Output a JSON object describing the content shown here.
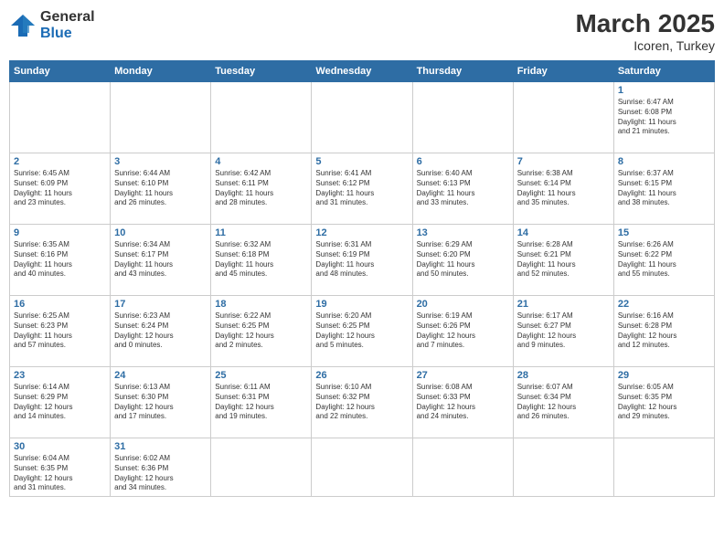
{
  "header": {
    "logo_general": "General",
    "logo_blue": "Blue",
    "title": "March 2025",
    "subtitle": "Icoren, Turkey"
  },
  "days_of_week": [
    "Sunday",
    "Monday",
    "Tuesday",
    "Wednesday",
    "Thursday",
    "Friday",
    "Saturday"
  ],
  "weeks": [
    [
      {
        "day": "",
        "info": ""
      },
      {
        "day": "",
        "info": ""
      },
      {
        "day": "",
        "info": ""
      },
      {
        "day": "",
        "info": ""
      },
      {
        "day": "",
        "info": ""
      },
      {
        "day": "",
        "info": ""
      },
      {
        "day": "1",
        "info": "Sunrise: 6:47 AM\nSunset: 6:08 PM\nDaylight: 11 hours\nand 21 minutes."
      }
    ],
    [
      {
        "day": "2",
        "info": "Sunrise: 6:45 AM\nSunset: 6:09 PM\nDaylight: 11 hours\nand 23 minutes."
      },
      {
        "day": "3",
        "info": "Sunrise: 6:44 AM\nSunset: 6:10 PM\nDaylight: 11 hours\nand 26 minutes."
      },
      {
        "day": "4",
        "info": "Sunrise: 6:42 AM\nSunset: 6:11 PM\nDaylight: 11 hours\nand 28 minutes."
      },
      {
        "day": "5",
        "info": "Sunrise: 6:41 AM\nSunset: 6:12 PM\nDaylight: 11 hours\nand 31 minutes."
      },
      {
        "day": "6",
        "info": "Sunrise: 6:40 AM\nSunset: 6:13 PM\nDaylight: 11 hours\nand 33 minutes."
      },
      {
        "day": "7",
        "info": "Sunrise: 6:38 AM\nSunset: 6:14 PM\nDaylight: 11 hours\nand 35 minutes."
      },
      {
        "day": "8",
        "info": "Sunrise: 6:37 AM\nSunset: 6:15 PM\nDaylight: 11 hours\nand 38 minutes."
      }
    ],
    [
      {
        "day": "9",
        "info": "Sunrise: 6:35 AM\nSunset: 6:16 PM\nDaylight: 11 hours\nand 40 minutes."
      },
      {
        "day": "10",
        "info": "Sunrise: 6:34 AM\nSunset: 6:17 PM\nDaylight: 11 hours\nand 43 minutes."
      },
      {
        "day": "11",
        "info": "Sunrise: 6:32 AM\nSunset: 6:18 PM\nDaylight: 11 hours\nand 45 minutes."
      },
      {
        "day": "12",
        "info": "Sunrise: 6:31 AM\nSunset: 6:19 PM\nDaylight: 11 hours\nand 48 minutes."
      },
      {
        "day": "13",
        "info": "Sunrise: 6:29 AM\nSunset: 6:20 PM\nDaylight: 11 hours\nand 50 minutes."
      },
      {
        "day": "14",
        "info": "Sunrise: 6:28 AM\nSunset: 6:21 PM\nDaylight: 11 hours\nand 52 minutes."
      },
      {
        "day": "15",
        "info": "Sunrise: 6:26 AM\nSunset: 6:22 PM\nDaylight: 11 hours\nand 55 minutes."
      }
    ],
    [
      {
        "day": "16",
        "info": "Sunrise: 6:25 AM\nSunset: 6:23 PM\nDaylight: 11 hours\nand 57 minutes."
      },
      {
        "day": "17",
        "info": "Sunrise: 6:23 AM\nSunset: 6:24 PM\nDaylight: 12 hours\nand 0 minutes."
      },
      {
        "day": "18",
        "info": "Sunrise: 6:22 AM\nSunset: 6:25 PM\nDaylight: 12 hours\nand 2 minutes."
      },
      {
        "day": "19",
        "info": "Sunrise: 6:20 AM\nSunset: 6:25 PM\nDaylight: 12 hours\nand 5 minutes."
      },
      {
        "day": "20",
        "info": "Sunrise: 6:19 AM\nSunset: 6:26 PM\nDaylight: 12 hours\nand 7 minutes."
      },
      {
        "day": "21",
        "info": "Sunrise: 6:17 AM\nSunset: 6:27 PM\nDaylight: 12 hours\nand 9 minutes."
      },
      {
        "day": "22",
        "info": "Sunrise: 6:16 AM\nSunset: 6:28 PM\nDaylight: 12 hours\nand 12 minutes."
      }
    ],
    [
      {
        "day": "23",
        "info": "Sunrise: 6:14 AM\nSunset: 6:29 PM\nDaylight: 12 hours\nand 14 minutes."
      },
      {
        "day": "24",
        "info": "Sunrise: 6:13 AM\nSunset: 6:30 PM\nDaylight: 12 hours\nand 17 minutes."
      },
      {
        "day": "25",
        "info": "Sunrise: 6:11 AM\nSunset: 6:31 PM\nDaylight: 12 hours\nand 19 minutes."
      },
      {
        "day": "26",
        "info": "Sunrise: 6:10 AM\nSunset: 6:32 PM\nDaylight: 12 hours\nand 22 minutes."
      },
      {
        "day": "27",
        "info": "Sunrise: 6:08 AM\nSunset: 6:33 PM\nDaylight: 12 hours\nand 24 minutes."
      },
      {
        "day": "28",
        "info": "Sunrise: 6:07 AM\nSunset: 6:34 PM\nDaylight: 12 hours\nand 26 minutes."
      },
      {
        "day": "29",
        "info": "Sunrise: 6:05 AM\nSunset: 6:35 PM\nDaylight: 12 hours\nand 29 minutes."
      }
    ],
    [
      {
        "day": "30",
        "info": "Sunrise: 6:04 AM\nSunset: 6:35 PM\nDaylight: 12 hours\nand 31 minutes."
      },
      {
        "day": "31",
        "info": "Sunrise: 6:02 AM\nSunset: 6:36 PM\nDaylight: 12 hours\nand 34 minutes."
      },
      {
        "day": "",
        "info": ""
      },
      {
        "day": "",
        "info": ""
      },
      {
        "day": "",
        "info": ""
      },
      {
        "day": "",
        "info": ""
      },
      {
        "day": "",
        "info": ""
      }
    ]
  ]
}
